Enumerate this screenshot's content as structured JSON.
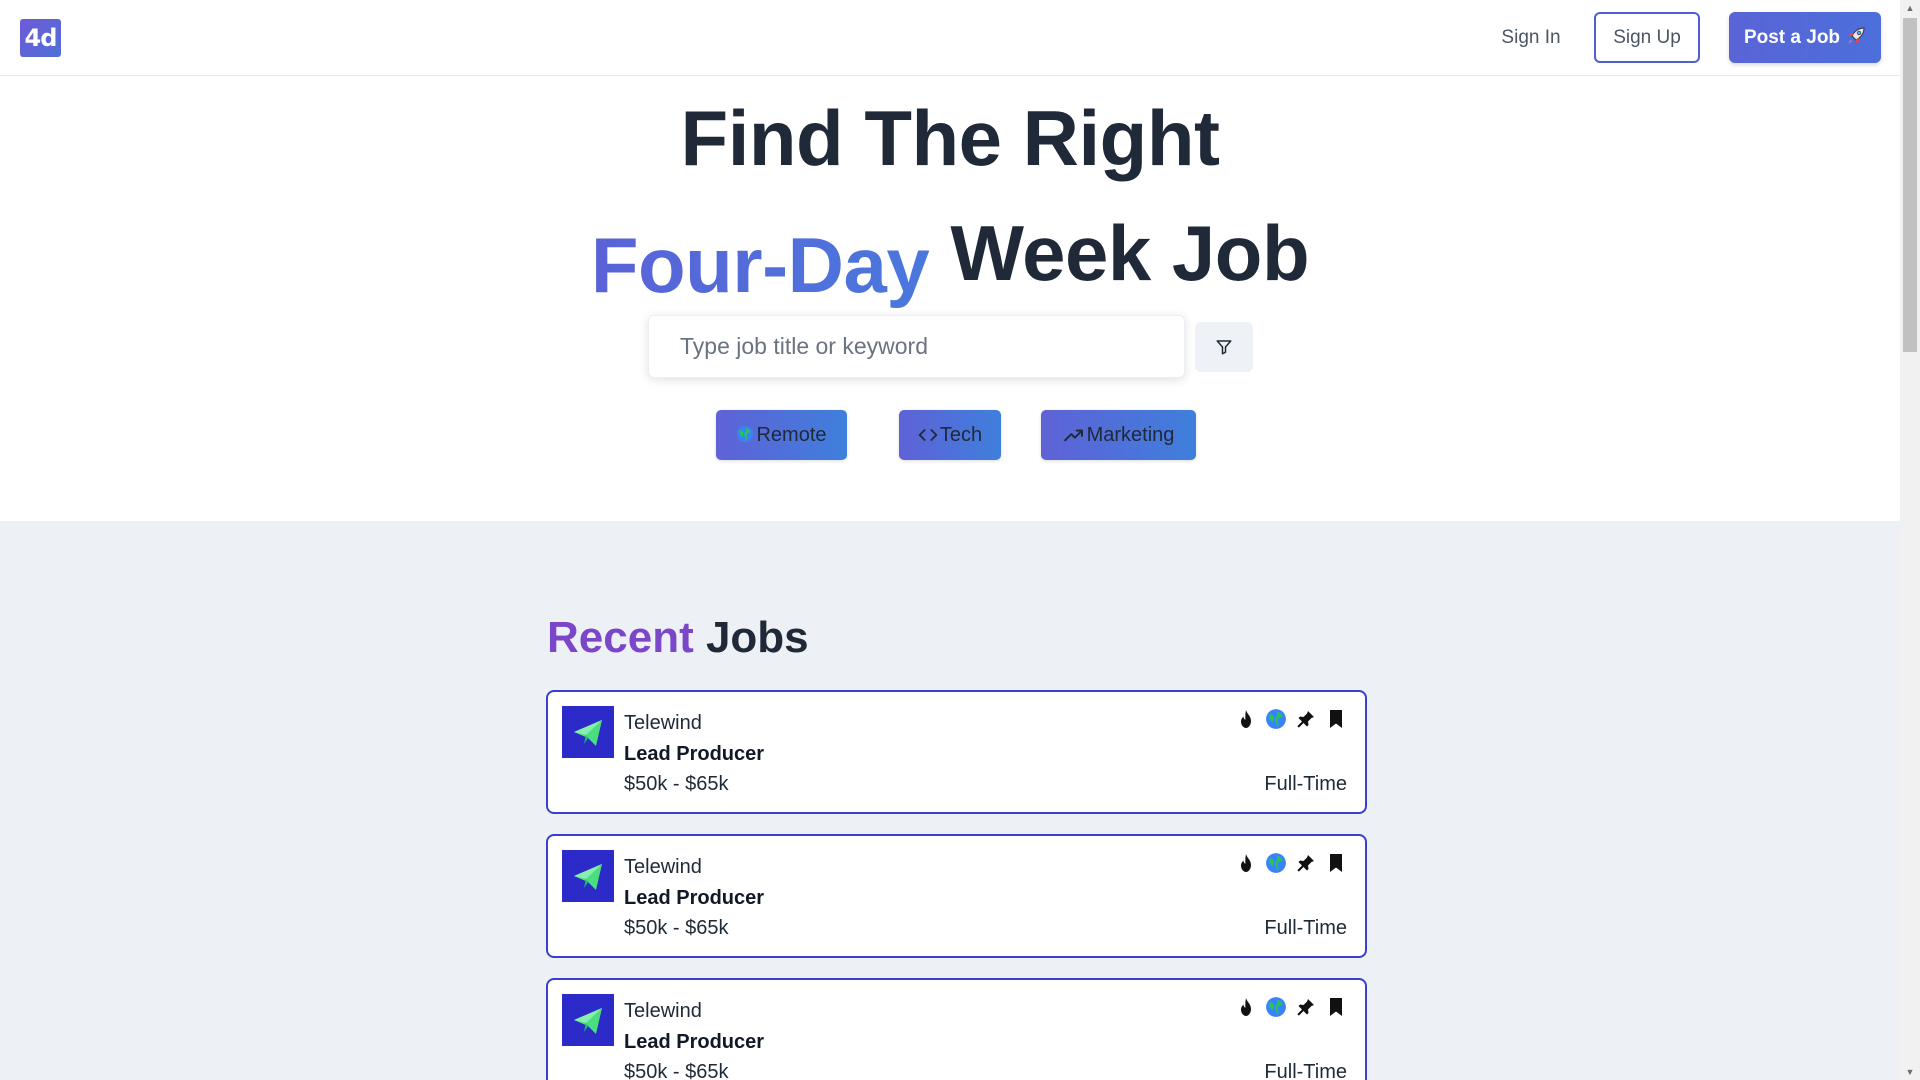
{
  "header": {
    "logo_text": "4d",
    "signin_label": "Sign In",
    "signup_label": "Sign Up",
    "postjob_label": "Post a Job"
  },
  "hero": {
    "line1": "Find The Right",
    "accent": "Four-Day",
    "line2_rest": "Week Job",
    "search_placeholder": "Type job title or keyword",
    "tags": [
      {
        "label": "Remote",
        "icon": "globe-icon"
      },
      {
        "label": "Tech",
        "icon": "code-icon"
      },
      {
        "label": "Marketing",
        "icon": "trending-up-icon"
      }
    ]
  },
  "jobs": {
    "section_title_accent": "Recent",
    "section_title_rest": "Jobs",
    "items": [
      {
        "company": "Telewind",
        "title": "Lead Producer",
        "salary": "$50k - $65k",
        "type": "Full-Time"
      },
      {
        "company": "Telewind",
        "title": "Lead Producer",
        "salary": "$50k - $65k",
        "type": "Full-Time"
      },
      {
        "company": "Telewind",
        "title": "Lead Producer",
        "salary": "$50k - $65k",
        "type": "Full-Time"
      }
    ]
  },
  "colors": {
    "brand_purple": "#7c46c8",
    "brand_blue": "#4f6fd8",
    "card_border": "#3b3fcf",
    "section_bg": "#edf1f5"
  }
}
